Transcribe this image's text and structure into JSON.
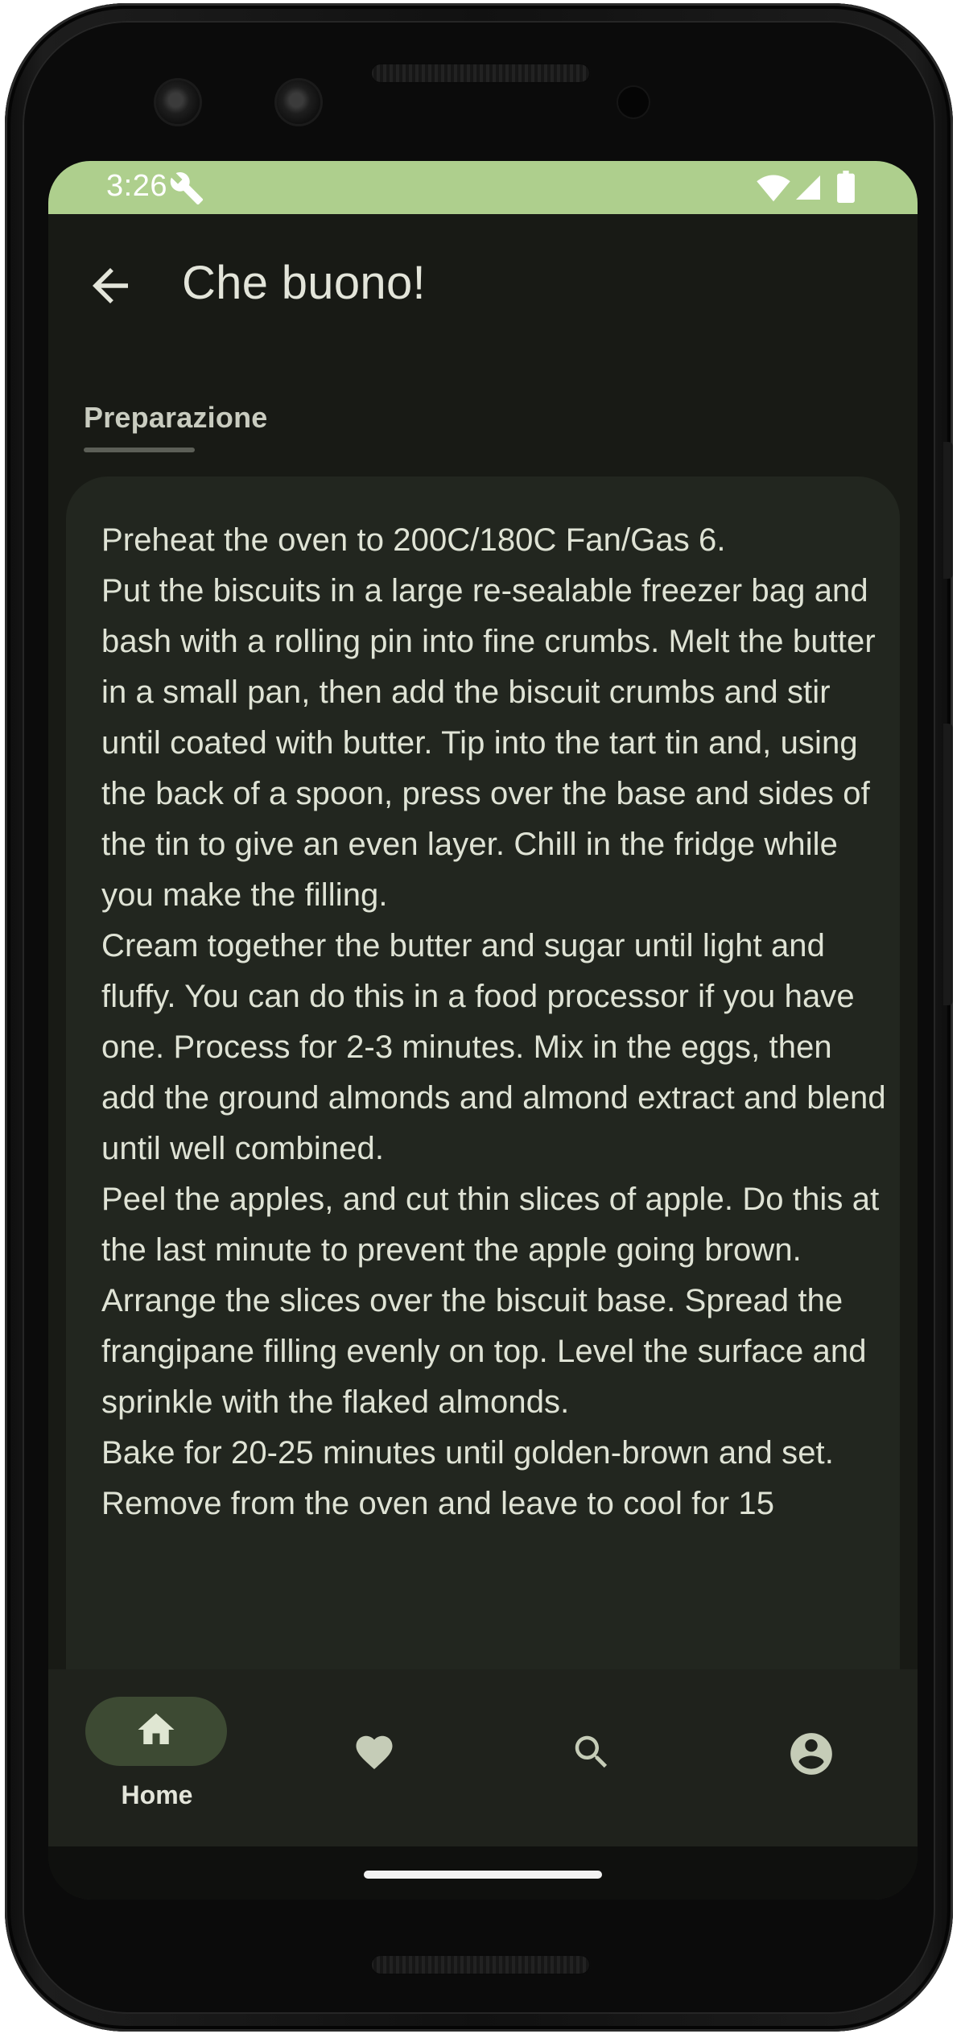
{
  "status_bar": {
    "time": "3:26",
    "background_color": "#aecf8d",
    "icons": [
      "wrench-icon",
      "wifi-icon",
      "signal-icon",
      "battery-icon"
    ]
  },
  "top_bar": {
    "back_icon": "arrow-back-icon",
    "title": "Che buono!"
  },
  "tabs": [
    {
      "label": "Preparazione",
      "selected": true
    }
  ],
  "recipe": {
    "steps_text": "Preheat the oven to 200C/180C Fan/Gas 6.\nPut the biscuits in a large re-sealable freezer bag and bash with a rolling pin into fine crumbs. Melt the butter in a small pan, then add the biscuit crumbs and stir until coated with butter. Tip into the tart tin and, using the back of a spoon, press over the base and sides of the tin to give an even layer. Chill in the fridge while you make the filling.\nCream together the butter and sugar until light and fluffy. You can do this in a food processor if you have one. Process for 2-3 minutes. Mix in the eggs, then add the ground almonds and almond extract and blend until well combined.\nPeel the apples, and cut thin slices of apple. Do this at the last minute to prevent the apple going brown. Arrange the slices over the biscuit base. Spread the frangipane filling evenly on top. Level the surface and sprinkle with the flaked almonds.\nBake for 20-25 minutes until golden-brown and set.\nRemove from the oven and leave to cool for 15"
  },
  "bottom_nav": {
    "items": [
      {
        "id": "home",
        "label": "Home",
        "icon": "home-icon",
        "selected": true
      },
      {
        "id": "favorites",
        "label": "",
        "icon": "heart-icon",
        "selected": false
      },
      {
        "id": "search",
        "label": "",
        "icon": "search-icon",
        "selected": false
      },
      {
        "id": "profile",
        "label": "",
        "icon": "account-circle-icon",
        "selected": false
      }
    ]
  },
  "colors": {
    "screen_background": "#181a15",
    "card_background": "#22261f",
    "nav_background": "#1f221c",
    "nav_pill": "#3d4a33",
    "icon_color": "#c5ccb7",
    "text_color": "#dfe3d5"
  }
}
